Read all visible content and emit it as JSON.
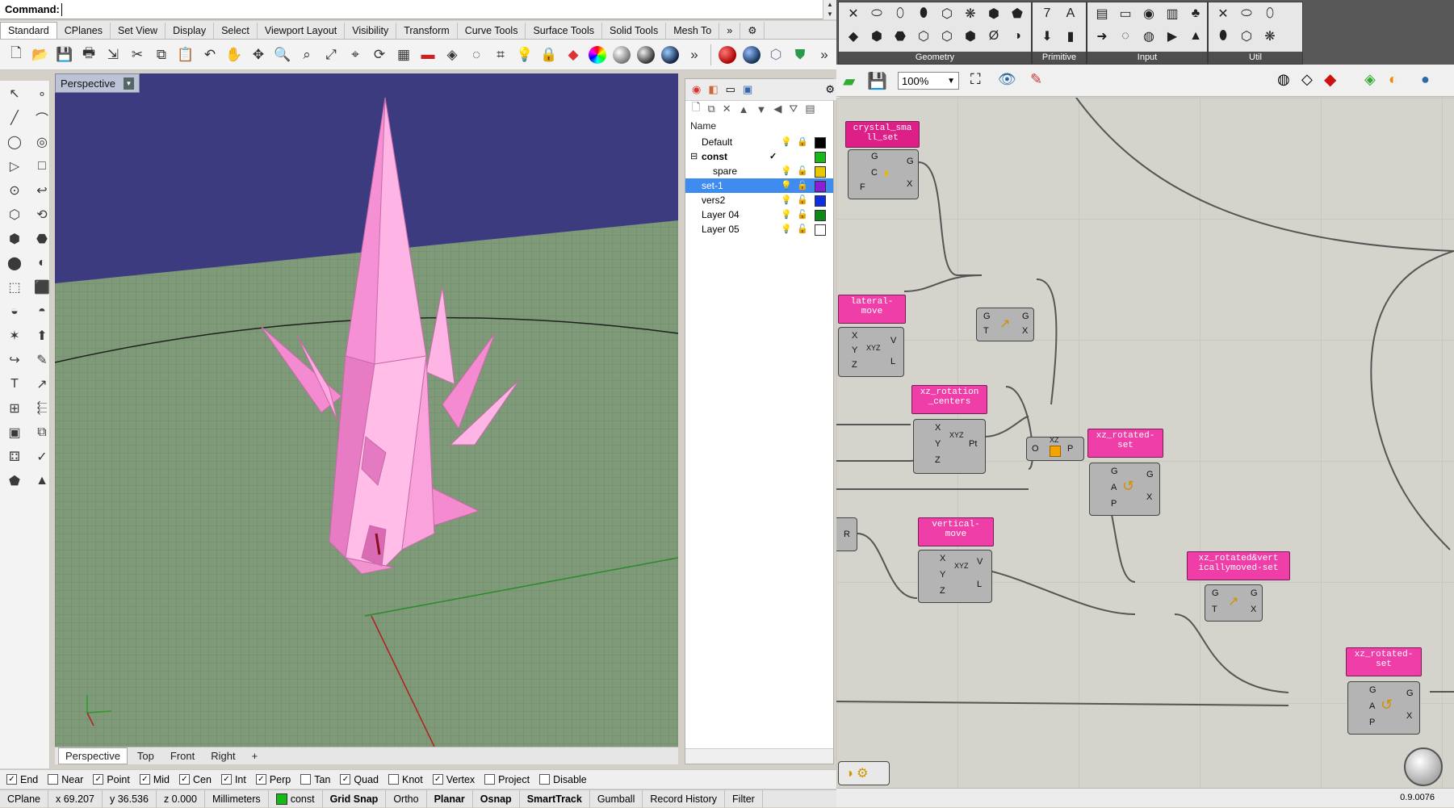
{
  "command": {
    "label": "Command:"
  },
  "toolbar_tabs": [
    "Standard",
    "CPlanes",
    "Set View",
    "Display",
    "Select",
    "Viewport Layout",
    "Visibility",
    "Transform",
    "Curve Tools",
    "Surface Tools",
    "Solid Tools",
    "Mesh To"
  ],
  "toolbar_more": "»",
  "viewport": {
    "title": "Perspective"
  },
  "viewport_tabs": [
    "Perspective",
    "Top",
    "Front",
    "Right",
    "+"
  ],
  "layers": {
    "header": "Name",
    "rows": [
      {
        "name": "Default",
        "swatch": "#000000"
      },
      {
        "name": "const",
        "swatch": "#18b818",
        "current": "✓"
      },
      {
        "name": "spare",
        "swatch": "#e8c800"
      },
      {
        "name": "set-1",
        "swatch": "#8c1ed8"
      },
      {
        "name": "vers2",
        "swatch": "#1030e0"
      },
      {
        "name": "Layer 04",
        "swatch": "#108818"
      },
      {
        "name": "Layer 05",
        "swatch": "#ffffff"
      }
    ]
  },
  "osnap": [
    {
      "label": "End",
      "checked": true
    },
    {
      "label": "Near",
      "checked": false
    },
    {
      "label": "Point",
      "checked": true
    },
    {
      "label": "Mid",
      "checked": true
    },
    {
      "label": "Cen",
      "checked": true
    },
    {
      "label": "Int",
      "checked": true
    },
    {
      "label": "Perp",
      "checked": true
    },
    {
      "label": "Tan",
      "checked": false
    },
    {
      "label": "Quad",
      "checked": true
    },
    {
      "label": "Knot",
      "checked": false
    },
    {
      "label": "Vertex",
      "checked": true
    },
    {
      "label": "Project",
      "checked": false
    },
    {
      "label": "Disable",
      "checked": false
    }
  ],
  "status": {
    "cplane": "CPlane",
    "x": "x 69.207",
    "y": "y 36.536",
    "z": "z 0.000",
    "units": "Millimeters",
    "layer": "const",
    "toggles": [
      "Grid Snap",
      "Ortho",
      "Planar",
      "Osnap",
      "SmartTrack",
      "Gumball",
      "Record History",
      "Filter"
    ]
  },
  "gh": {
    "groups": [
      "Geometry",
      "Primitive",
      "Input",
      "Util"
    ],
    "zoom": "100%",
    "version": "0.9.0076",
    "labels": {
      "crystal": "crystal_sma\nll_set",
      "lateral": "lateral-\nmove",
      "xz_rot_centers": "xz_rotation\n_centers",
      "xz_rotated_set": "xz_rotated-\nset",
      "vertical": "vertical-\nmove",
      "xz_rot_vert": "xz_rotated&vert\nicallymoved-set",
      "xz_rotated_set2": "xz_rotated-\nset"
    },
    "ports": {
      "G": "G",
      "C": "C",
      "F": "F",
      "X": "X",
      "Y": "Y",
      "Z": "Z",
      "V": "V",
      "L": "L",
      "T": "T",
      "A": "A",
      "P": "P",
      "Pt": "Pt",
      "O": "O",
      "R": "R",
      "XZ": "XZ",
      "XYZ": "XYZ"
    }
  },
  "colors": {
    "viewport_sky": "#3d3b80",
    "model_pink": "#f48ad0",
    "param_magenta": "#f03ea8"
  }
}
